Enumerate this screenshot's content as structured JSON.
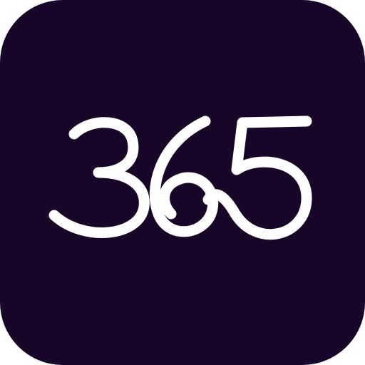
{
  "app_icon": {
    "logo_text": "365",
    "background_color": "#170628",
    "glyph_color": "#ffffff"
  }
}
